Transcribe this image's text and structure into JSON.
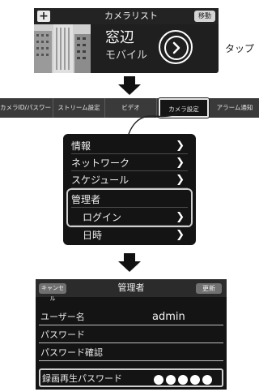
{
  "camera_list": {
    "add_label": "+",
    "title": "カメラリスト",
    "move_label": "移動",
    "camera": {
      "name": "窓辺",
      "type": "モバイル"
    }
  },
  "annotation": {
    "tap_label": "タップ"
  },
  "tabs": [
    {
      "label": "カメラID/パスワード"
    },
    {
      "label": "ストリーム設定"
    },
    {
      "label": "ビデオ"
    },
    {
      "label": "カメラ設定"
    },
    {
      "label": "アラーム通知"
    }
  ],
  "settings_menu": {
    "items": [
      {
        "label": "情報"
      },
      {
        "label": "ネットワーク"
      },
      {
        "label": "スケジュール"
      },
      {
        "label": "管理者"
      },
      {
        "label": "ログイン"
      },
      {
        "label": "日時"
      }
    ]
  },
  "admin": {
    "cancel_label": "キャンセル",
    "title": "管理者",
    "update_label": "更新",
    "rows": [
      {
        "label": "ユーザー名",
        "value": "admin"
      },
      {
        "label": "パスワード",
        "value": ""
      },
      {
        "label": "パスワード確認",
        "value": ""
      },
      {
        "label": "録画再生パスワード",
        "value": ""
      }
    ]
  },
  "colors": {
    "dark_panel": "#141414",
    "highlight_frame": "#cfcfcf"
  },
  "icons": {
    "go": "chevron-right-circle-icon",
    "down_arrow": "arrow-down-icon"
  }
}
